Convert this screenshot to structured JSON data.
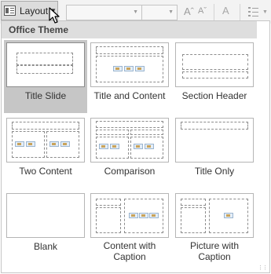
{
  "ribbon": {
    "layout_label": "Layout",
    "grow_font_glyph": "Aˆ",
    "shrink_font_glyph": "Aˇ",
    "clear_format_glyph": "A"
  },
  "panel": {
    "header": "Office Theme",
    "layouts": [
      {
        "label": "Title Slide",
        "selected": true
      },
      {
        "label": "Title and Content",
        "selected": false
      },
      {
        "label": "Section Header",
        "selected": false
      },
      {
        "label": "Two Content",
        "selected": false
      },
      {
        "label": "Comparison",
        "selected": false
      },
      {
        "label": "Title Only",
        "selected": false
      },
      {
        "label": "Blank",
        "selected": false
      },
      {
        "label": "Content with Caption",
        "selected": false
      },
      {
        "label": "Picture with Caption",
        "selected": false
      }
    ]
  },
  "icons": [
    "layout-icon",
    "mouse-cursor-icon",
    "grow-font-icon",
    "shrink-font-icon",
    "clear-formatting-icon",
    "bullets-icon",
    "resize-grip-icon"
  ],
  "colors": {
    "selected_tile": "#c6c6c6",
    "header_band": "#dedede",
    "placeholder_border": "#8d8d8d"
  }
}
